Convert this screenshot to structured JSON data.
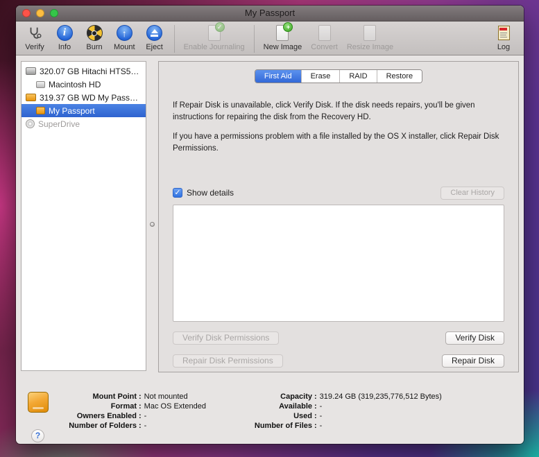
{
  "window": {
    "title": "My Passport"
  },
  "colors": {
    "accent_blue": "#3268d8",
    "selection_blue": "#2e63cf",
    "drive_orange": "#f0a02e"
  },
  "icons": {
    "check": "✓",
    "info_glyph": "i",
    "plus": "+",
    "up_arrow": "↑",
    "help": "?"
  },
  "toolbar": {
    "items": [
      {
        "label": "Verify"
      },
      {
        "label": "Info"
      },
      {
        "label": "Burn"
      },
      {
        "label": "Mount"
      },
      {
        "label": "Eject"
      },
      {
        "label": "Enable Journaling"
      },
      {
        "label": "New Image"
      },
      {
        "label": "Convert"
      },
      {
        "label": "Resize Image"
      }
    ],
    "log_label": "Log"
  },
  "sidebar": {
    "items": [
      {
        "label": "320.07 GB Hitachi HTS5…"
      },
      {
        "label": "Macintosh HD"
      },
      {
        "label": "319.37 GB WD My Pass…"
      },
      {
        "label": "My Passport"
      },
      {
        "label": "SuperDrive"
      }
    ]
  },
  "tabs": [
    {
      "label": "First Aid"
    },
    {
      "label": "Erase"
    },
    {
      "label": "RAID"
    },
    {
      "label": "Restore"
    }
  ],
  "first_aid": {
    "paragraph1": "If Repair Disk is unavailable, click Verify Disk. If the disk needs repairs, you'll be given instructions for repairing the disk from the Recovery HD.",
    "paragraph2": "If you have a permissions problem with a file installed by the OS X installer, click Repair Disk Permissions.",
    "show_details_label": "Show details",
    "clear_history_label": "Clear History",
    "details_output": "",
    "verify_permissions_label": "Verify Disk Permissions",
    "verify_disk_label": "Verify Disk",
    "repair_permissions_label": "Repair Disk Permissions",
    "repair_disk_label": "Repair Disk"
  },
  "info": {
    "sep": ":",
    "left": [
      {
        "label": "Mount Point",
        "value": "Not mounted"
      },
      {
        "label": "Format",
        "value": "Mac OS Extended"
      },
      {
        "label": "Owners Enabled",
        "value": "-"
      },
      {
        "label": "Number of Folders",
        "value": "-"
      }
    ],
    "right": [
      {
        "label": "Capacity",
        "value": "319.24 GB (319,235,776,512 Bytes)"
      },
      {
        "label": "Available",
        "value": "-"
      },
      {
        "label": "Used",
        "value": "-"
      },
      {
        "label": "Number of Files",
        "value": "-"
      }
    ]
  }
}
